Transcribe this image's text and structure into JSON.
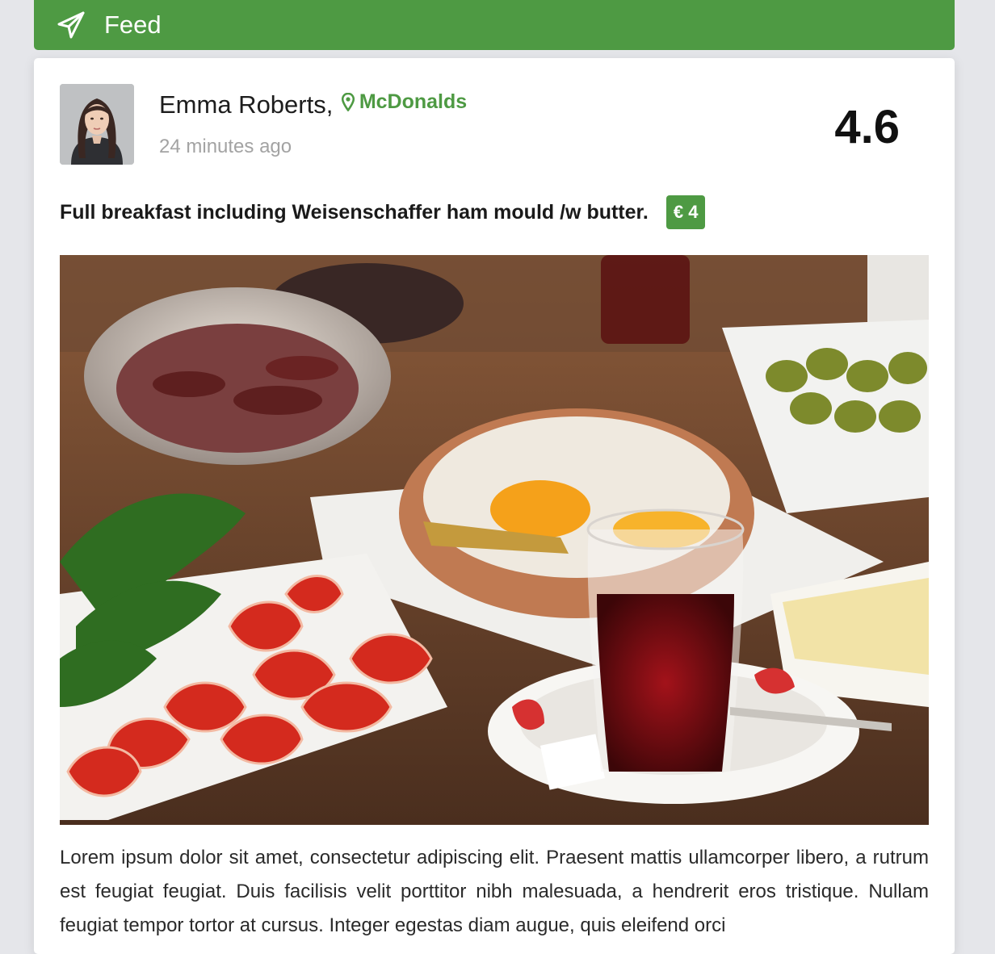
{
  "header": {
    "title": "Feed",
    "icon": "paper-plane-icon",
    "color": "#4e9a43"
  },
  "post": {
    "author": "Emma Roberts",
    "separator": ",",
    "place_icon": "map-marker-icon",
    "place": "McDonalds",
    "time": "24 minutes ago",
    "rating": "4.6",
    "description": "Full breakfast including Weisenschaffer ham mould /w butter.",
    "price": "€ 4",
    "body": "Lorem ipsum dolor sit amet, consectetur adipiscing elit. Praesent mattis ullamcorper libero, a rutrum est feugiat feugiat. Duis facilisis velit porttitor nibh malesuada, a hendrerit eros tristique. Nullam feugiat tempor tortor at cursus. Integer egestas diam augue, quis eleifend orci"
  },
  "colors": {
    "accent": "#4e9a43",
    "background": "#e5e6ea",
    "card": "#ffffff"
  }
}
